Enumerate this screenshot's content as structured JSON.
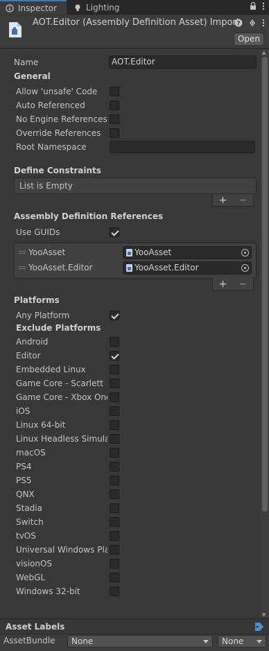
{
  "tabs": [
    {
      "label": "Inspector",
      "icon": "info-icon",
      "active": true
    },
    {
      "label": "Lighting",
      "icon": "bulb-icon",
      "active": false
    }
  ],
  "header": {
    "title": "AOT.Editor (Assembly Definition Asset) Import",
    "open_label": "Open"
  },
  "fields": {
    "name_label": "Name",
    "name_value": "AOT.Editor"
  },
  "general": {
    "title": "General",
    "items": [
      {
        "label": "Allow 'unsafe' Code",
        "checked": false
      },
      {
        "label": "Auto Referenced",
        "checked": false
      },
      {
        "label": "No Engine References",
        "checked": false
      },
      {
        "label": "Override References",
        "checked": false
      }
    ],
    "root_namespace_label": "Root Namespace",
    "root_namespace_value": ""
  },
  "define_constraints": {
    "title": "Define Constraints",
    "empty_text": "List is Empty"
  },
  "assembly_refs": {
    "title": "Assembly Definition References",
    "use_guids_label": "Use GUIDs",
    "use_guids_checked": true,
    "items": [
      {
        "label": "YooAsset",
        "value": "YooAsset"
      },
      {
        "label": "YooAsset.Editor",
        "value": "YooAsset.Editor"
      }
    ]
  },
  "platforms": {
    "title": "Platforms",
    "any_platform_label": "Any Platform",
    "any_platform_checked": true,
    "exclude_title": "Exclude Platforms",
    "items": [
      {
        "label": "Android",
        "checked": false
      },
      {
        "label": "Editor",
        "checked": true
      },
      {
        "label": "Embedded Linux",
        "checked": false
      },
      {
        "label": "Game Core - Scarlett",
        "checked": false
      },
      {
        "label": "Game Core - Xbox One",
        "checked": false
      },
      {
        "label": "iOS",
        "checked": false
      },
      {
        "label": "Linux 64-bit",
        "checked": false
      },
      {
        "label": "Linux Headless Simulati",
        "checked": false
      },
      {
        "label": "macOS",
        "checked": false
      },
      {
        "label": "PS4",
        "checked": false
      },
      {
        "label": "PS5",
        "checked": false
      },
      {
        "label": "QNX",
        "checked": false
      },
      {
        "label": "Stadia",
        "checked": false
      },
      {
        "label": "Switch",
        "checked": false
      },
      {
        "label": "tvOS",
        "checked": false
      },
      {
        "label": "Universal Windows Plat",
        "checked": false
      },
      {
        "label": "visionOS",
        "checked": false
      },
      {
        "label": "WebGL",
        "checked": false
      },
      {
        "label": "Windows 32-bit",
        "checked": false
      }
    ]
  },
  "asset_labels": {
    "title": "Asset Labels",
    "assetbundle_label": "AssetBundle",
    "bundle_value": "None",
    "variant_value": "None"
  },
  "colors": {
    "background": "#383838",
    "accent": "#3a79bb"
  }
}
